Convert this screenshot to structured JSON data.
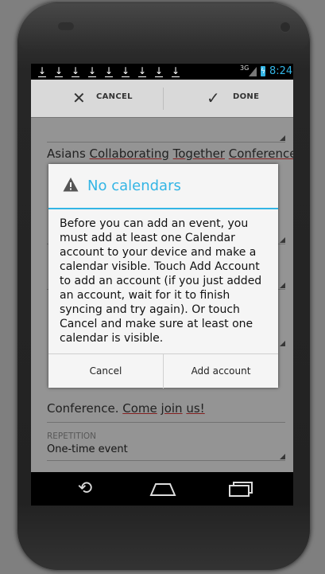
{
  "status_bar": {
    "notification_icons": [
      "download-icon",
      "download-icon",
      "download-icon",
      "download-icon",
      "download-icon",
      "download-icon",
      "download-icon",
      "download-icon",
      "download-icon"
    ],
    "network": "3G",
    "time": "8:24"
  },
  "action_bar": {
    "cancel_label": "CANCEL",
    "done_label": "DONE"
  },
  "form": {
    "title_value_words": [
      "Asians",
      "Collaborating",
      "Together",
      "Conference"
    ],
    "description_words": [
      "Conference.",
      "Come",
      "join",
      "us!"
    ],
    "repetition_label": "REPETITION",
    "repetition_value": "One-time event"
  },
  "dialog": {
    "title": "No calendars",
    "message": "Before you can add an event, you must add at least one Calendar account to your device and make a calendar visible. Touch Add Account to add an account (if you just added an account, wait for it to finish syncing and try again). Or touch Cancel and make sure at least one calendar is visible.",
    "cancel_label": "Cancel",
    "add_account_label": "Add account"
  },
  "colors": {
    "accent": "#33b5e5",
    "spell_error": "#cc3333"
  }
}
